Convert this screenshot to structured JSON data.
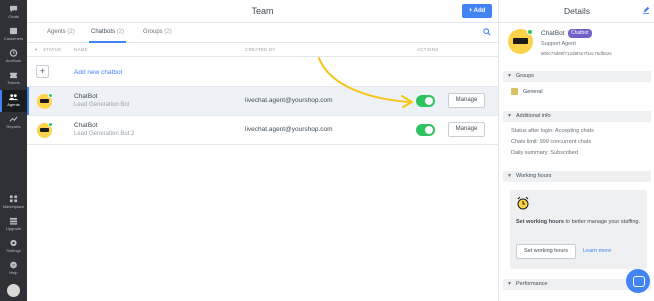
{
  "nav": {
    "items": [
      {
        "label": "Chats",
        "icon": "chat-icon"
      },
      {
        "label": "Customers",
        "icon": "customers-icon"
      },
      {
        "label": "Archives",
        "icon": "archives-icon"
      },
      {
        "label": "Tickets",
        "icon": "tickets-icon"
      },
      {
        "label": "Agents",
        "icon": "agents-icon"
      },
      {
        "label": "Reports",
        "icon": "reports-icon"
      }
    ],
    "bottom_items": [
      {
        "label": "Marketplace",
        "icon": "marketplace-icon"
      },
      {
        "label": "Upgrade",
        "icon": "upgrade-icon"
      },
      {
        "label": "Settings",
        "icon": "settings-icon"
      },
      {
        "label": "Help",
        "icon": "help-icon"
      }
    ]
  },
  "header": {
    "title": "Team",
    "add_label": "+ Add"
  },
  "tabs": [
    {
      "label": "Agents",
      "count": "(2)"
    },
    {
      "label": "Chatbots",
      "count": "(2)"
    },
    {
      "label": "Groups",
      "count": "(2)"
    }
  ],
  "table": {
    "headers": {
      "status": "STATUS",
      "name": "NAME",
      "created_by": "CREATED BY",
      "actions": "ACTIONS"
    },
    "add_label": "Add new chatbot",
    "rows": [
      {
        "name": "ChatBot",
        "subtitle": "Lead Generation Bot",
        "created_by": "livechat.agent@yourshop.com",
        "enabled": true,
        "action": "Manage"
      },
      {
        "name": "ChatBot",
        "subtitle": "Lead Generation Bot 2",
        "created_by": "livechat.agent@yourshop.com",
        "enabled": true,
        "action": "Manage"
      }
    ]
  },
  "details": {
    "title": "Details",
    "name": "ChatBot",
    "badge": "Chatbot",
    "role": "Support Agent",
    "id": "900c73d80f712d8f4e7f1ec75db62e",
    "groups_title": "Groups",
    "group_name": "General",
    "info_title": "Additional info",
    "info": [
      "Status after login: Accepting chats",
      "Chats limit: 999 concurrent chats",
      "Daily summary: Subscribed"
    ],
    "hours_title": "Working hours",
    "hours_text_bold": "Set working hours",
    "hours_text_rest": " to better manage your staffing.",
    "hours_button": "Set working hours",
    "hours_link": "Learn more",
    "performance_title": "Performance"
  },
  "colors": {
    "accent": "#4384f5",
    "toggle_on": "#2fc262",
    "badge": "#7160c9",
    "arrow": "#f5c518"
  }
}
